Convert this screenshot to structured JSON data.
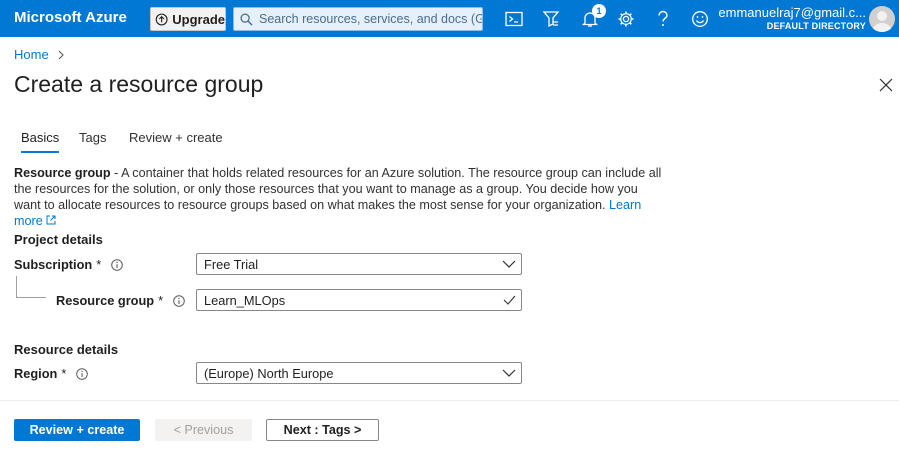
{
  "topbar": {
    "brand": "Microsoft Azure",
    "upgrade_label": "Upgrade",
    "search_placeholder": "Search resources, services, and docs (G+/)",
    "notification_count": "1",
    "account_email": "emmanuelraj7@gmail.c...",
    "account_directory": "DEFAULT DIRECTORY",
    "icons": [
      "cloud-shell-icon",
      "directory-filter-icon",
      "notifications-icon",
      "settings-icon",
      "help-icon",
      "feedback-icon"
    ]
  },
  "breadcrumb": {
    "home": "Home"
  },
  "page": {
    "title": "Create a resource group"
  },
  "tabs": [
    {
      "label": "Basics",
      "active": true
    },
    {
      "label": "Tags",
      "active": false
    },
    {
      "label": "Review + create",
      "active": false
    }
  ],
  "description": {
    "term": "Resource group",
    "text": " - A container that holds related resources for an Azure solution. The resource group can include all the resources for the solution, or only those resources that you want to manage as a group. You decide how you want to allocate resources to resource groups based on what makes the most sense for your organization. ",
    "link": "Learn more"
  },
  "project_details": {
    "heading": "Project details",
    "subscription": {
      "label": "Subscription",
      "required": "*",
      "value": "Free Trial"
    },
    "resource_group": {
      "label": "Resource group",
      "required": "*",
      "value": "Learn_MLOps"
    }
  },
  "resource_details": {
    "heading": "Resource details",
    "region": {
      "label": "Region",
      "required": "*",
      "value": "(Europe) North Europe"
    }
  },
  "footer": {
    "review_create": "Review + create",
    "previous": "< Previous",
    "next": "Next : Tags >"
  },
  "colors": {
    "accent": "#0078d4",
    "text": "#323130",
    "disabled": "#a19f9d"
  }
}
